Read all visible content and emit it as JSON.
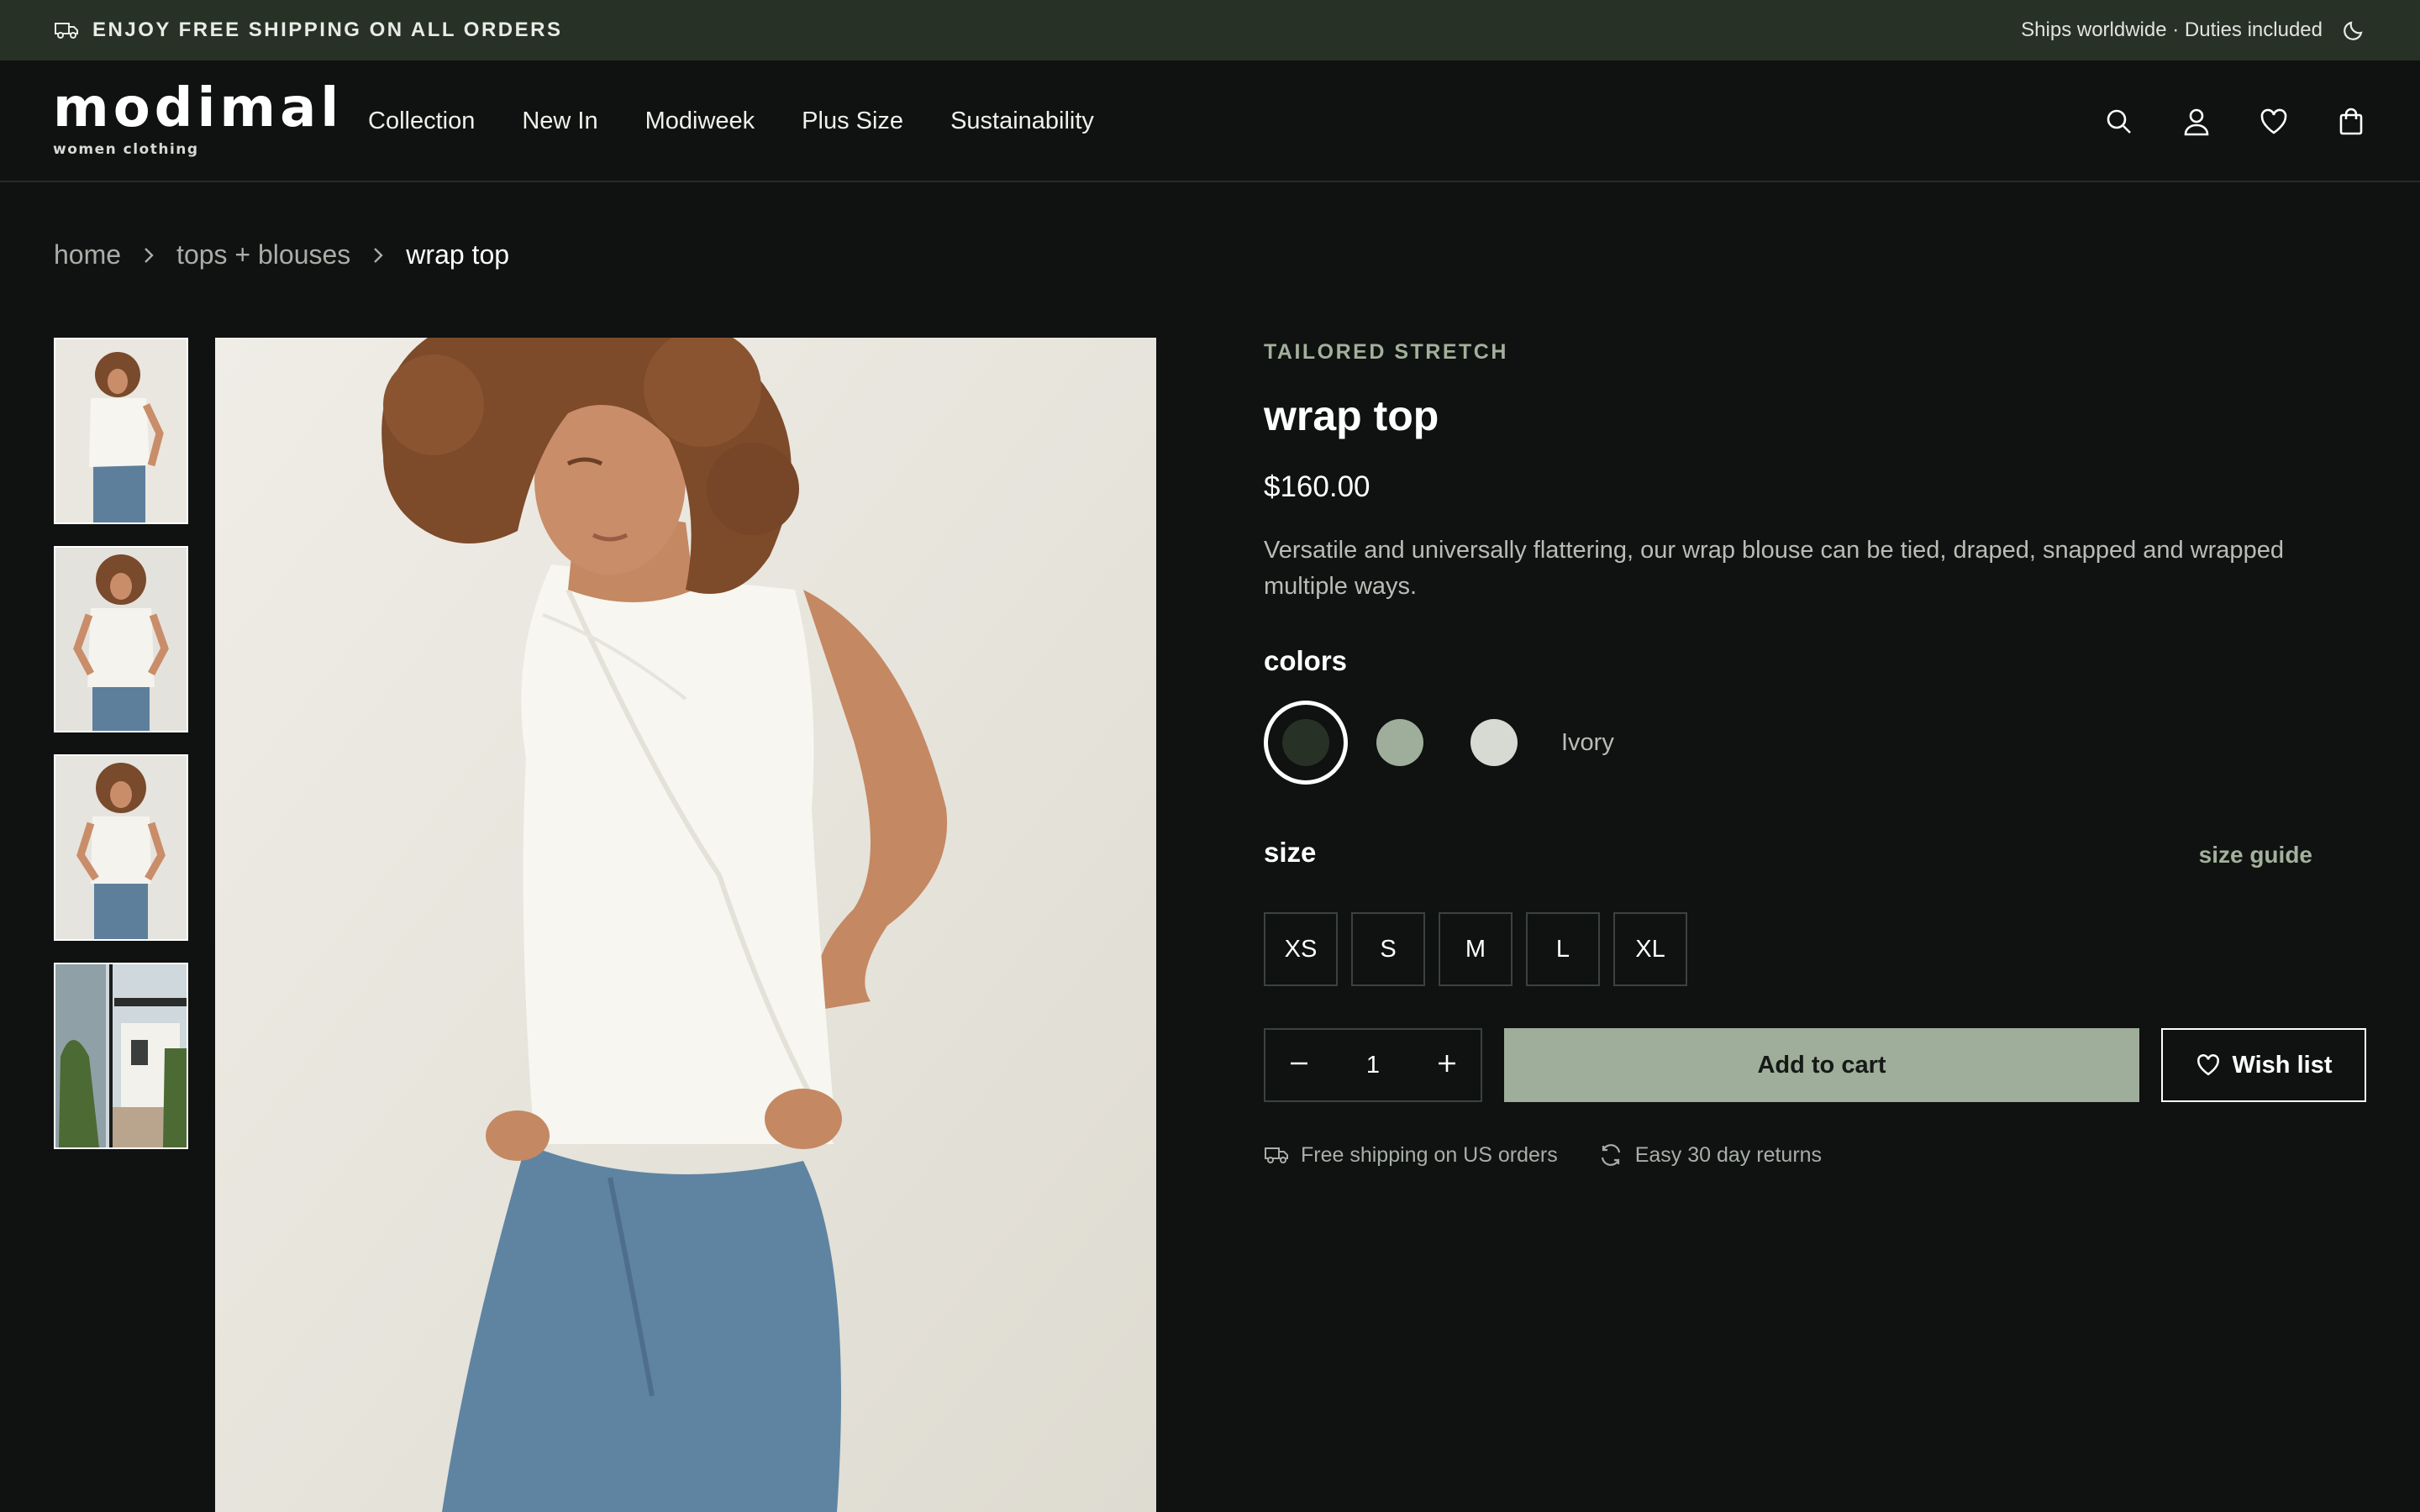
{
  "announcement": {
    "left_text": "ENJOY FREE SHIPPING ON ALL ORDERS",
    "right_text": "Ships worldwide · Duties included",
    "truck_icon": "truck-icon",
    "theme_icon": "moon-icon"
  },
  "header": {
    "logo_main": "modimal",
    "logo_sub": "women clothing",
    "nav": [
      "Collection",
      "New In",
      "Modiweek",
      "Plus Size",
      "Sustainability"
    ],
    "icons": [
      "search-icon",
      "user-icon",
      "heart-icon",
      "shopping-bag-icon"
    ]
  },
  "breadcrumb": [
    "home",
    "tops + blouses",
    "wrap top"
  ],
  "gallery": {
    "thumbnails": [
      "front view",
      "front view close",
      "front view hands on hips",
      "outdoor lifestyle"
    ],
    "selected_index": 0
  },
  "product": {
    "brand_tag": "TAILORED STRETCH",
    "title": "wrap top",
    "price": "$160.00",
    "description": "Versatile and universally flattering, our wrap blouse can be tied, draped, snapped and wrapped multiple ways.",
    "colors_label": "colors",
    "colors": [
      {
        "hex": "#283126",
        "selected": true
      },
      {
        "hex": "#9fae9a",
        "selected": false
      },
      {
        "hex": "#d6dad3",
        "selected": false
      }
    ],
    "selected_color_name": "Ivory",
    "size_label": "size",
    "size_guide": "size guide",
    "sizes": [
      "XS",
      "S",
      "M",
      "L",
      "XL"
    ],
    "quantity": "1",
    "add_to_cart": "Add to cart",
    "wishlist": "Wish list",
    "perks": [
      "Free shipping on US orders",
      "Easy 30 day returns"
    ]
  },
  "theme": {
    "background": "#0f1210",
    "announcement_bg": "#283126",
    "accent": "#9fae9a",
    "text": "#ffffff"
  }
}
